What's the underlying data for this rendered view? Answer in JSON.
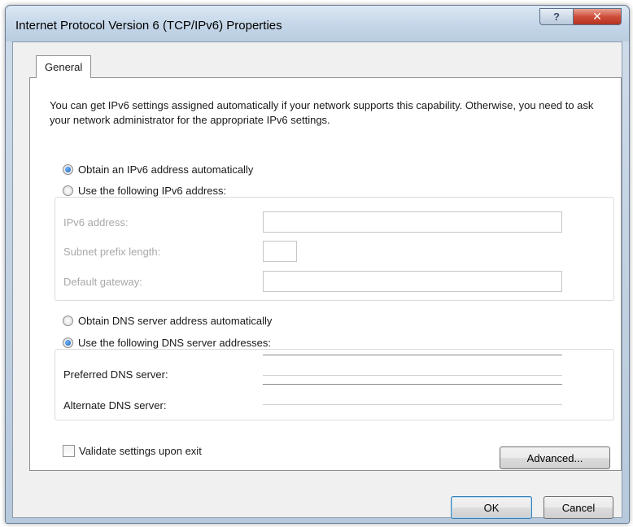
{
  "window": {
    "title": "Internet Protocol Version 6 (TCP/IPv6) Properties",
    "help_label": "?",
    "close_label": "✕"
  },
  "tabs": [
    {
      "label": "General",
      "selected": true
    }
  ],
  "description": "You can get IPv6 settings assigned automatically if your network supports this capability. Otherwise, you need to ask your network administrator for the appropriate IPv6 settings.",
  "address": {
    "auto_label": "Obtain an IPv6 address automatically",
    "auto_selected": true,
    "manual_label": "Use the following IPv6 address:",
    "manual_selected": false,
    "fields": {
      "ipv6_label": "IPv6 address:",
      "ipv6_value": "",
      "prefix_label": "Subnet prefix length:",
      "prefix_value": "",
      "gateway_label": "Default gateway:",
      "gateway_value": ""
    }
  },
  "dns": {
    "auto_label": "Obtain DNS server address automatically",
    "auto_selected": false,
    "manual_label": "Use the following DNS server addresses:",
    "manual_selected": true,
    "preferred_label": "Preferred DNS server:",
    "preferred_value": "",
    "alternate_label": "Alternate DNS server:",
    "alternate_value": ""
  },
  "validate": {
    "label": "Validate settings upon exit",
    "checked": false
  },
  "buttons": {
    "advanced": "Advanced...",
    "ok": "OK",
    "cancel": "Cancel"
  },
  "colors": {
    "accent": "#1c5fb6",
    "close": "#cf4e3a"
  }
}
